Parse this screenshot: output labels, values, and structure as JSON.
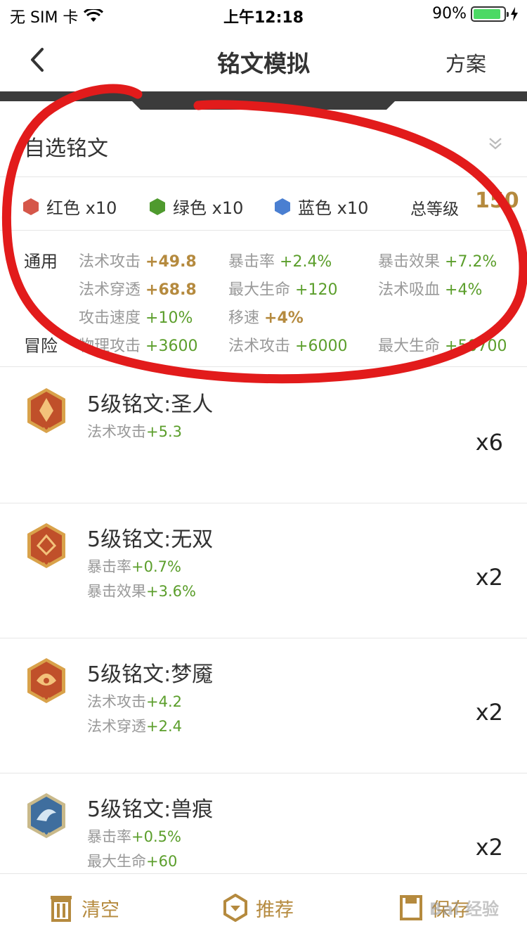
{
  "status_bar": {
    "carrier": "无 SIM 卡",
    "time": "上午12:18",
    "battery": "90%",
    "battery_level": 0.9
  },
  "nav": {
    "title": "铭文模拟",
    "right": "方案"
  },
  "summary": {
    "select_label": "自选铭文",
    "colors": [
      {
        "label": "红色 x10",
        "color": "#d5574a"
      },
      {
        "label": "绿色 x10",
        "color": "#4f9a2e"
      },
      {
        "label": "蓝色 x10",
        "color": "#4a7fd1"
      }
    ],
    "total_label": "总等级",
    "total_value": "150",
    "general_label": "通用",
    "adventure_label": "冒险",
    "general_stats": [
      {
        "name": "法术攻击",
        "value": "+49.8"
      },
      {
        "name": "暴击率",
        "value": "+2.4%"
      },
      {
        "name": "暴击效果",
        "value": "+7.2%"
      },
      {
        "name": "法术穿透",
        "value": "+68.8"
      },
      {
        "name": "最大生命",
        "value": "+120"
      },
      {
        "name": "法术吸血",
        "value": "+4%"
      },
      {
        "name": "攻击速度",
        "value": "+10%"
      },
      {
        "name": "移速",
        "value": "+4%"
      }
    ],
    "adventure_stats": [
      {
        "name": "物理攻击",
        "value": "+3600"
      },
      {
        "name": "法术攻击",
        "value": "+6000"
      },
      {
        "name": "最大生命",
        "value": "+50700"
      }
    ]
  },
  "runes": [
    {
      "name": "5级铭文:圣人",
      "count": "x6",
      "color": "#c0502a",
      "stats": [
        {
          "name": "法术攻击",
          "value": "+5.3"
        }
      ]
    },
    {
      "name": "5级铭文:无双",
      "count": "x2",
      "color": "#c0502a",
      "stats": [
        {
          "name": "暴击率",
          "value": "+0.7%"
        },
        {
          "name": "暴击效果",
          "value": "+3.6%"
        }
      ]
    },
    {
      "name": "5级铭文:梦魇",
      "count": "x2",
      "color": "#c0502a",
      "stats": [
        {
          "name": "法术攻击",
          "value": "+4.2"
        },
        {
          "name": "法术穿透",
          "value": "+2.4"
        }
      ]
    },
    {
      "name": "5级铭文:兽痕",
      "count": "x2",
      "color": "#3f6e9e",
      "stats": [
        {
          "name": "暴击率",
          "value": "+0.5%"
        },
        {
          "name": "最大生命",
          "value": "+60"
        }
      ]
    }
  ],
  "bottom_bar": {
    "clear": "清空",
    "recommend": "推荐",
    "save": "保存",
    "watermark": "Bai 经验"
  },
  "colors": {
    "accent_gold": "#b58a3e",
    "value_green": "#5b9e2b",
    "annotation_red": "#e21b1b"
  }
}
